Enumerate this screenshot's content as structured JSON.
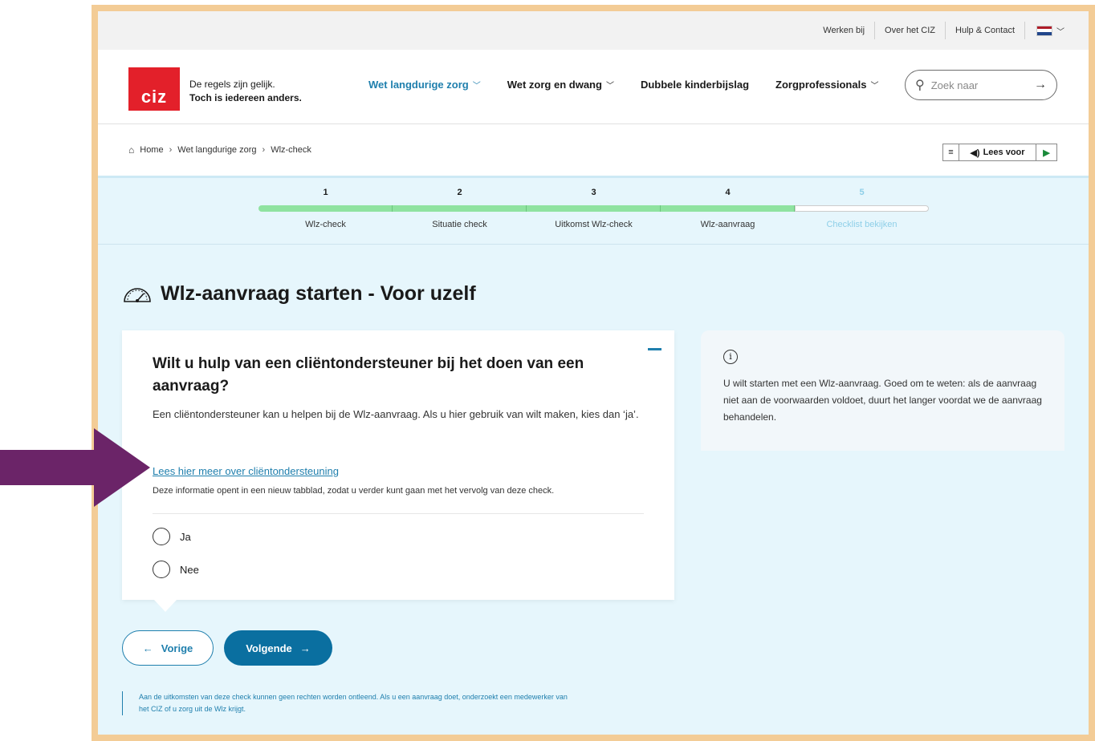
{
  "topbar": {
    "links": [
      "Werken bij",
      "Over het CIZ",
      "Hulp & Contact"
    ],
    "language_flag": "flag-nl-icon"
  },
  "header": {
    "logo_text": "ciz",
    "tagline_line1": "De regels zijn gelijk.",
    "tagline_line2": "Toch is iedereen anders.",
    "nav": [
      {
        "label": "Wet langdurige zorg",
        "dropdown": true,
        "active": true
      },
      {
        "label": "Wet zorg en dwang",
        "dropdown": true,
        "active": false
      },
      {
        "label": "Dubbele kinderbijslag",
        "dropdown": false,
        "active": false
      },
      {
        "label": "Zorgprofessionals",
        "dropdown": true,
        "active": false
      }
    ],
    "search_placeholder": "Zoek naar"
  },
  "breadcrumb": {
    "items": [
      "Home",
      "Wet langdurige zorg",
      "Wlz-check"
    ]
  },
  "readspeaker": {
    "label": "Lees voor"
  },
  "stepper": {
    "steps": [
      {
        "num": "1",
        "label": "Wlz-check",
        "done": true
      },
      {
        "num": "2",
        "label": "Situatie check",
        "done": true
      },
      {
        "num": "3",
        "label": "Uitkomst Wlz-check",
        "done": true
      },
      {
        "num": "4",
        "label": "Wlz-aanvraag",
        "done": true
      },
      {
        "num": "5",
        "label": "Checklist bekijken",
        "done": false
      }
    ]
  },
  "main": {
    "title": "Wlz-aanvraag starten - Voor uzelf",
    "question": {
      "heading": "Wilt u hulp van een cliëntondersteuner bij het doen van een aanvraag?",
      "description": "Een cliëntondersteuner kan u helpen bij de Wlz-aanvraag. Als u hier gebruik van wilt maken, kies dan ‘ja’.",
      "link": "Lees hier meer over cliëntondersteuning",
      "note": "Deze informatie opent in een nieuw tabblad, zodat u verder kunt gaan met het vervolg van deze check.",
      "options": [
        "Ja",
        "Nee"
      ]
    },
    "info": {
      "text": "U wilt starten met een Wlz-aanvraag. Goed om te weten: als de aanvraag niet aan de voorwaarden voldoet, duurt het langer voordat we de aanvraag behandelen."
    },
    "buttons": {
      "prev": "Vorige",
      "next": "Volgende"
    },
    "disclaimer": "Aan de uitkomsten van deze check kunnen geen rechten worden ontleend. Als u een aanvraag doet, onderzoekt een medewerker van het CIZ of u zorg uit de Wlz krijgt."
  },
  "colors": {
    "frame": "#f3cc96",
    "page_bg": "#e6f6fc",
    "accent": "#1f7fad",
    "logo": "#e3202a",
    "progress": "#8fe3a0",
    "arrow": "#6b2468"
  }
}
